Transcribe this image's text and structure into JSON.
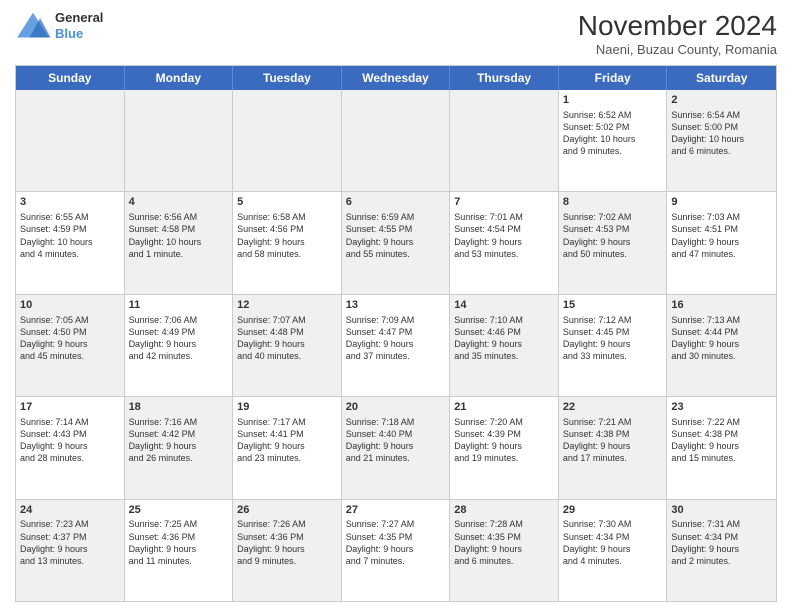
{
  "header": {
    "logo_line1": "General",
    "logo_line2": "Blue",
    "month_title": "November 2024",
    "subtitle": "Naeni, Buzau County, Romania"
  },
  "weekdays": [
    "Sunday",
    "Monday",
    "Tuesday",
    "Wednesday",
    "Thursday",
    "Friday",
    "Saturday"
  ],
  "rows": [
    [
      {
        "day": "",
        "info": "",
        "shaded": true
      },
      {
        "day": "",
        "info": "",
        "shaded": true
      },
      {
        "day": "",
        "info": "",
        "shaded": true
      },
      {
        "day": "",
        "info": "",
        "shaded": true
      },
      {
        "day": "",
        "info": "",
        "shaded": true
      },
      {
        "day": "1",
        "info": "Sunrise: 6:52 AM\nSunset: 5:02 PM\nDaylight: 10 hours\nand 9 minutes."
      },
      {
        "day": "2",
        "info": "Sunrise: 6:54 AM\nSunset: 5:00 PM\nDaylight: 10 hours\nand 6 minutes.",
        "shaded": true
      }
    ],
    [
      {
        "day": "3",
        "info": "Sunrise: 6:55 AM\nSunset: 4:59 PM\nDaylight: 10 hours\nand 4 minutes."
      },
      {
        "day": "4",
        "info": "Sunrise: 6:56 AM\nSunset: 4:58 PM\nDaylight: 10 hours\nand 1 minute.",
        "shaded": true
      },
      {
        "day": "5",
        "info": "Sunrise: 6:58 AM\nSunset: 4:56 PM\nDaylight: 9 hours\nand 58 minutes."
      },
      {
        "day": "6",
        "info": "Sunrise: 6:59 AM\nSunset: 4:55 PM\nDaylight: 9 hours\nand 55 minutes.",
        "shaded": true
      },
      {
        "day": "7",
        "info": "Sunrise: 7:01 AM\nSunset: 4:54 PM\nDaylight: 9 hours\nand 53 minutes."
      },
      {
        "day": "8",
        "info": "Sunrise: 7:02 AM\nSunset: 4:53 PM\nDaylight: 9 hours\nand 50 minutes.",
        "shaded": true
      },
      {
        "day": "9",
        "info": "Sunrise: 7:03 AM\nSunset: 4:51 PM\nDaylight: 9 hours\nand 47 minutes."
      }
    ],
    [
      {
        "day": "10",
        "info": "Sunrise: 7:05 AM\nSunset: 4:50 PM\nDaylight: 9 hours\nand 45 minutes.",
        "shaded": true
      },
      {
        "day": "11",
        "info": "Sunrise: 7:06 AM\nSunset: 4:49 PM\nDaylight: 9 hours\nand 42 minutes."
      },
      {
        "day": "12",
        "info": "Sunrise: 7:07 AM\nSunset: 4:48 PM\nDaylight: 9 hours\nand 40 minutes.",
        "shaded": true
      },
      {
        "day": "13",
        "info": "Sunrise: 7:09 AM\nSunset: 4:47 PM\nDaylight: 9 hours\nand 37 minutes."
      },
      {
        "day": "14",
        "info": "Sunrise: 7:10 AM\nSunset: 4:46 PM\nDaylight: 9 hours\nand 35 minutes.",
        "shaded": true
      },
      {
        "day": "15",
        "info": "Sunrise: 7:12 AM\nSunset: 4:45 PM\nDaylight: 9 hours\nand 33 minutes."
      },
      {
        "day": "16",
        "info": "Sunrise: 7:13 AM\nSunset: 4:44 PM\nDaylight: 9 hours\nand 30 minutes.",
        "shaded": true
      }
    ],
    [
      {
        "day": "17",
        "info": "Sunrise: 7:14 AM\nSunset: 4:43 PM\nDaylight: 9 hours\nand 28 minutes."
      },
      {
        "day": "18",
        "info": "Sunrise: 7:16 AM\nSunset: 4:42 PM\nDaylight: 9 hours\nand 26 minutes.",
        "shaded": true
      },
      {
        "day": "19",
        "info": "Sunrise: 7:17 AM\nSunset: 4:41 PM\nDaylight: 9 hours\nand 23 minutes."
      },
      {
        "day": "20",
        "info": "Sunrise: 7:18 AM\nSunset: 4:40 PM\nDaylight: 9 hours\nand 21 minutes.",
        "shaded": true
      },
      {
        "day": "21",
        "info": "Sunrise: 7:20 AM\nSunset: 4:39 PM\nDaylight: 9 hours\nand 19 minutes."
      },
      {
        "day": "22",
        "info": "Sunrise: 7:21 AM\nSunset: 4:38 PM\nDaylight: 9 hours\nand 17 minutes.",
        "shaded": true
      },
      {
        "day": "23",
        "info": "Sunrise: 7:22 AM\nSunset: 4:38 PM\nDaylight: 9 hours\nand 15 minutes."
      }
    ],
    [
      {
        "day": "24",
        "info": "Sunrise: 7:23 AM\nSunset: 4:37 PM\nDaylight: 9 hours\nand 13 minutes.",
        "shaded": true
      },
      {
        "day": "25",
        "info": "Sunrise: 7:25 AM\nSunset: 4:36 PM\nDaylight: 9 hours\nand 11 minutes."
      },
      {
        "day": "26",
        "info": "Sunrise: 7:26 AM\nSunset: 4:36 PM\nDaylight: 9 hours\nand 9 minutes.",
        "shaded": true
      },
      {
        "day": "27",
        "info": "Sunrise: 7:27 AM\nSunset: 4:35 PM\nDaylight: 9 hours\nand 7 minutes."
      },
      {
        "day": "28",
        "info": "Sunrise: 7:28 AM\nSunset: 4:35 PM\nDaylight: 9 hours\nand 6 minutes.",
        "shaded": true
      },
      {
        "day": "29",
        "info": "Sunrise: 7:30 AM\nSunset: 4:34 PM\nDaylight: 9 hours\nand 4 minutes."
      },
      {
        "day": "30",
        "info": "Sunrise: 7:31 AM\nSunset: 4:34 PM\nDaylight: 9 hours\nand 2 minutes.",
        "shaded": true
      }
    ]
  ]
}
